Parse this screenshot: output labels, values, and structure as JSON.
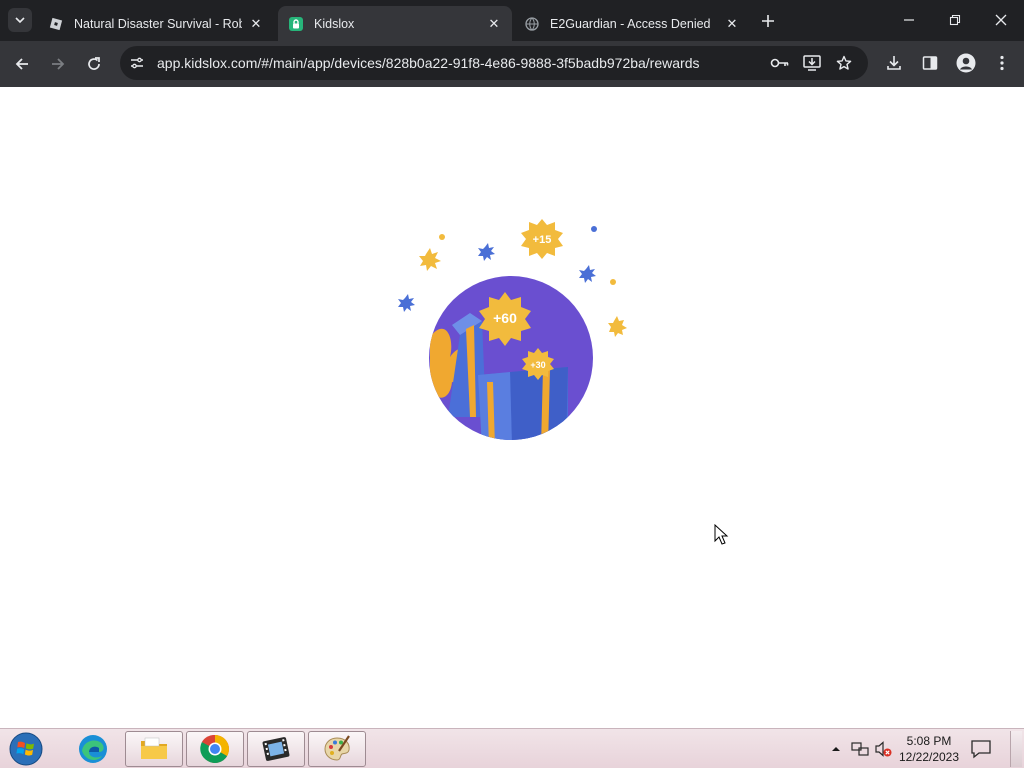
{
  "browser": {
    "tabs": [
      {
        "title": "Natural Disaster Survival - Robl",
        "favicon": "roblox-icon",
        "active": false
      },
      {
        "title": "Kidslox",
        "favicon": "kidslox-lock-icon",
        "active": true
      },
      {
        "title": "E2Guardian - Access Denied",
        "favicon": "globe-icon",
        "active": false
      }
    ],
    "url": "app.kidslox.com/#/main/app/devices/828b0a22-91f8-4e86-9888-3f5badb972ba/rewards",
    "colors": {
      "tabstrip": "#202124",
      "toolbar": "#35363a",
      "omnibox": "#202124",
      "text": "#e8eaed"
    }
  },
  "page": {
    "illustration": {
      "name": "rewards-gift-illustration",
      "badges": [
        "+60",
        "+30",
        "+15"
      ],
      "colors": {
        "circle": "#6a4fd0",
        "gift": "#4b6fd8",
        "ribbon": "#f0a830",
        "star": "#f2bb3d",
        "dot": "#4a6fd6"
      }
    }
  },
  "taskbar": {
    "apps": [
      "edge-icon",
      "file-explorer-icon",
      "chrome-icon",
      "movie-maker-icon",
      "paint-icon"
    ],
    "clock": {
      "time": "5:08 PM",
      "date": "12/22/2023"
    }
  }
}
